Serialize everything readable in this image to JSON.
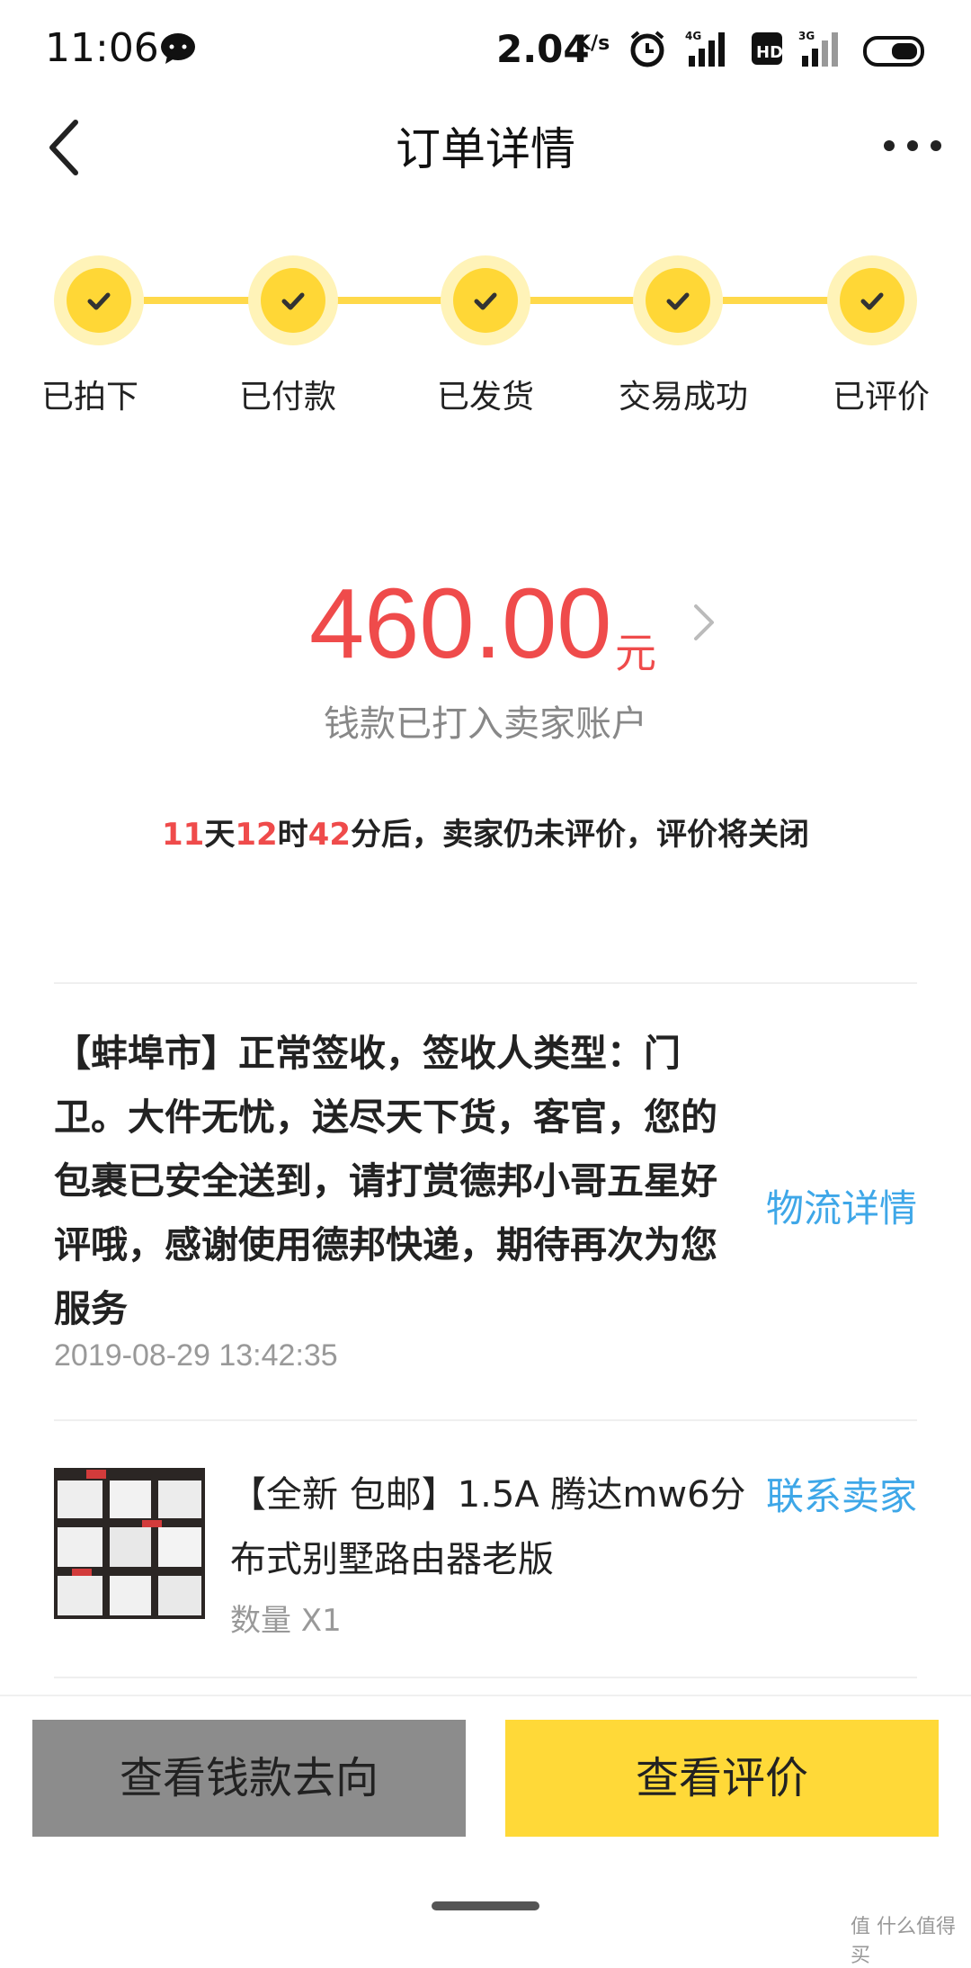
{
  "status_bar": {
    "time": "11:06",
    "net_speed": "2.04",
    "net_unit": "K/s",
    "icons": [
      "chat-bubble-icon",
      "alarm-icon",
      "signal-4g-icon",
      "hd-icon",
      "signal-3g-icon",
      "battery-icon"
    ]
  },
  "nav": {
    "title": "订单详情"
  },
  "steps": [
    {
      "label": "已拍下"
    },
    {
      "label": "已付款"
    },
    {
      "label": "已发货"
    },
    {
      "label": "交易成功"
    },
    {
      "label": "已评价"
    }
  ],
  "amount": {
    "value": "460.00",
    "unit": "元",
    "note": "钱款已打入卖家账户"
  },
  "countdown": {
    "days": "11",
    "days_label": "天",
    "hours": "12",
    "hours_label": "时",
    "minutes": "42",
    "rest": "分后，卖家仍未评价，评价将关闭"
  },
  "logistics": {
    "text": "【蚌埠市】正常签收，签收人类型：门卫。大件无忧，送尽天下货，客官，您的包裹已安全送到，请打赏德邦小哥五星好评哦，感谢使用德邦快递，期待再次为您服务",
    "time": "2019-08-29 13:42:35",
    "link": "物流详情"
  },
  "product": {
    "title": "【全新 包邮】1.5A 腾达mw6分布式别墅路由器老版",
    "qty": "数量 X1",
    "contact": "联系卖家"
  },
  "buttons": {
    "money_flow": "查看钱款去向",
    "view_review": "查看评价"
  },
  "watermark": "值 什么值得买",
  "colors": {
    "accent_yellow": "#ffd938",
    "price_red": "#ef4b4b",
    "link_blue": "#3ea7e8"
  }
}
